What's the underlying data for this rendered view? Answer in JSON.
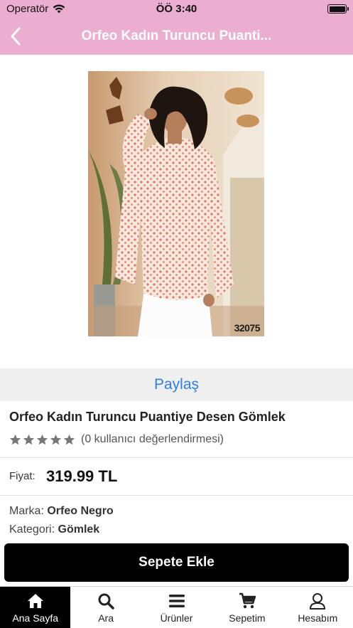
{
  "status_bar": {
    "carrier": "Operatör",
    "time": "ÖÖ 3:40",
    "battery_level": 1.0
  },
  "nav": {
    "title": "Orfeo Kadın Turuncu Puanti...",
    "back_icon": "chevron-left-icon",
    "background_color": "#ebaed0"
  },
  "product": {
    "image_label": "32075",
    "share_label": "Paylaş",
    "title": "Orfeo Kadın Turuncu Puantiye Desen Gömlek",
    "rating_stars": 5,
    "rating_text": "(0 kullanıcı değerlendirmesi)",
    "price_label": "Fiyat:",
    "price": "319.99 TL",
    "brand_label": "Marka:",
    "brand": "Orfeo Negro",
    "category_label": "Kategori:",
    "category": "Gömlek"
  },
  "cart_button": {
    "label": "Sepete Ekle"
  },
  "tabs": [
    {
      "label": "Ana Sayfa",
      "icon": "home-icon",
      "active": true
    },
    {
      "label": "Ara",
      "icon": "search-icon",
      "active": false
    },
    {
      "label": "Ürünler",
      "icon": "menu-icon",
      "active": false
    },
    {
      "label": "Sepetim",
      "icon": "cart-icon",
      "active": false
    },
    {
      "label": "Hesabım",
      "icon": "user-icon",
      "active": false
    }
  ],
  "colors": {
    "accent_pink": "#ebaed0",
    "share_blue": "#2f7fe0",
    "button_black": "#000000"
  }
}
